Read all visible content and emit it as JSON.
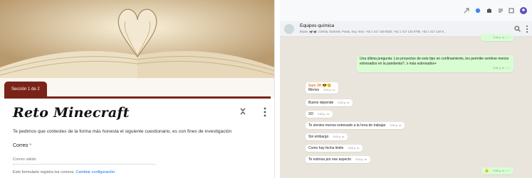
{
  "forms": {
    "section_tab": "Sección 1 de 2",
    "title": "Reto Minecraft",
    "description": "Te pedimos que contestes de la forma más honesta el siguiente cuestionario, es con fines de investigación",
    "email_label": "Correo",
    "required_mark": "*",
    "email_placeholder": "Correo válido",
    "footer_text": "Este formulario registra los correos.",
    "footer_link": "Cambiar configuración",
    "icons": [
      "collapse-icon",
      "more-vert-icon"
    ],
    "accent_color": "#7a2419"
  },
  "whatsapp": {
    "group_name": "Equipos química",
    "members": "Bryan, 🦋🦋, Cinthia, Damaris, Paola, Soy, Xavi, +52 1 417 100 5530, +52 1 417 124 8790, +52 1 417 140 9...",
    "messages": [
      {
        "dir": "out",
        "text": "",
        "time": "3:49 p. m."
      },
      {
        "dir": "out",
        "text": "Una última pregunta: Los proyectos de este tipo en confinamiento, les permitie sentirse menos estresados en la pandemia?, o más estresados+",
        "time": "3:52 p. m."
      },
      {
        "dir": "in",
        "sender": "Sam 3H 😎😊",
        "text": "Menos",
        "time": "3:53 p. m."
      },
      {
        "dir": "in",
        "text": "Bueno depende",
        "time": "3:53 p. m."
      },
      {
        "dir": "in",
        "text": "XD",
        "time": "3:53 p. m."
      },
      {
        "dir": "in",
        "text": "Te sientes menos estresado a la hora de trabajar",
        "time": "3:53 p. m."
      },
      {
        "dir": "in",
        "text": "Sin embargo",
        "time": "3:53 p. m."
      },
      {
        "dir": "in",
        "text": "Como hay fecha limite",
        "time": "3:53 p. m."
      },
      {
        "dir": "in",
        "text": "Te estresa por ese aspecto",
        "time": "3:53 p. m."
      },
      {
        "dir": "out",
        "text": "👍",
        "time": "3:53 p. m."
      }
    ],
    "icons": [
      "search-icon",
      "menu-icon",
      "extension-icons"
    ],
    "accent_color": "#d9fdd3"
  }
}
